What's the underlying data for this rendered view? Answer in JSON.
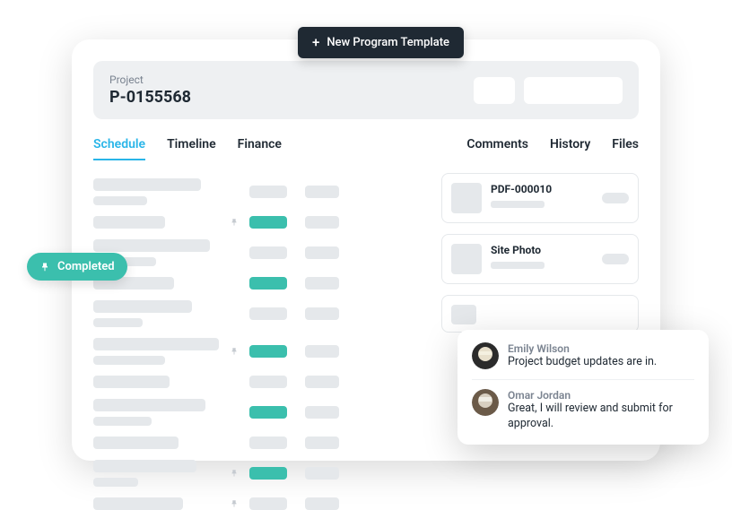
{
  "topButton": {
    "label": "New Program Template"
  },
  "project": {
    "label": "Project",
    "id": "P-0155568"
  },
  "tabs": {
    "left": [
      {
        "label": "Schedule",
        "active": true
      },
      {
        "label": "Timeline",
        "active": false
      },
      {
        "label": "Finance",
        "active": false
      }
    ],
    "right": [
      {
        "label": "Comments"
      },
      {
        "label": "History"
      },
      {
        "label": "Files"
      }
    ]
  },
  "completedBadge": {
    "label": "Completed"
  },
  "files": [
    {
      "title": "PDF-000010"
    },
    {
      "title": "Site Photo"
    }
  ],
  "comments": [
    {
      "name": "Emily Wilson",
      "text": "Project budget updates are in."
    },
    {
      "name": "Omar Jordan",
      "text": "Great, I will review and submit for approval."
    }
  ],
  "scheduleRows": [
    {
      "pin": false,
      "status": "grey"
    },
    {
      "pin": true,
      "status": "teal"
    },
    {
      "pin": false,
      "status": "grey"
    },
    {
      "pin": false,
      "status": "teal"
    },
    {
      "pin": false,
      "status": "grey"
    },
    {
      "pin": true,
      "status": "teal"
    },
    {
      "pin": false,
      "status": "grey"
    },
    {
      "pin": false,
      "status": "teal"
    },
    {
      "pin": false,
      "status": "grey"
    },
    {
      "pin": true,
      "status": "teal"
    },
    {
      "pin": true,
      "status": "grey"
    }
  ]
}
